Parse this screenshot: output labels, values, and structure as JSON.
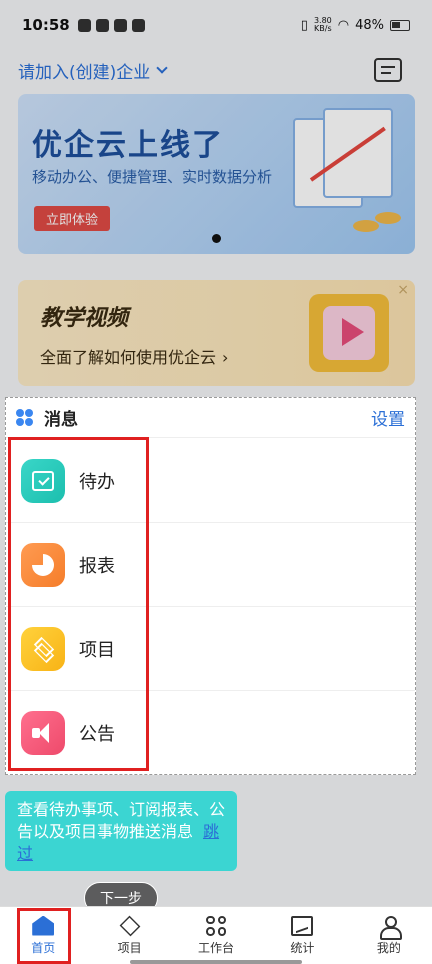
{
  "status_bar": {
    "time": "10:58",
    "network_speed": "3.80\nKB/s",
    "battery": "48%"
  },
  "header": {
    "enterprise_selector": "请加入(创建)企业"
  },
  "banner": {
    "title": "优企云上线了",
    "subtitle": "移动办公、便捷管理、实时数据分析",
    "button": "立即体验"
  },
  "video_card": {
    "title": "教学视频",
    "description": "全面了解如何使用优企云",
    "close": "×"
  },
  "messages": {
    "title": "消息",
    "settings": "设置",
    "items": [
      {
        "label": "待办",
        "icon": "calendar-check-icon"
      },
      {
        "label": "报表",
        "icon": "pie-chart-icon"
      },
      {
        "label": "项目",
        "icon": "layers-icon"
      },
      {
        "label": "公告",
        "icon": "megaphone-icon"
      }
    ]
  },
  "guide": {
    "tip": "查看待办事项、订阅报表、公告以及项目事物推送消息",
    "skip": "跳过",
    "next": "下一步"
  },
  "tabbar": {
    "items": [
      {
        "label": "首页",
        "active": true
      },
      {
        "label": "项目",
        "active": false
      },
      {
        "label": "工作台",
        "active": false
      },
      {
        "label": "统计",
        "active": false
      },
      {
        "label": "我的",
        "active": false
      }
    ]
  },
  "colors": {
    "accent": "#2b6fd6",
    "highlight": "#e02020",
    "tip_bg": "#3bd5d2"
  }
}
